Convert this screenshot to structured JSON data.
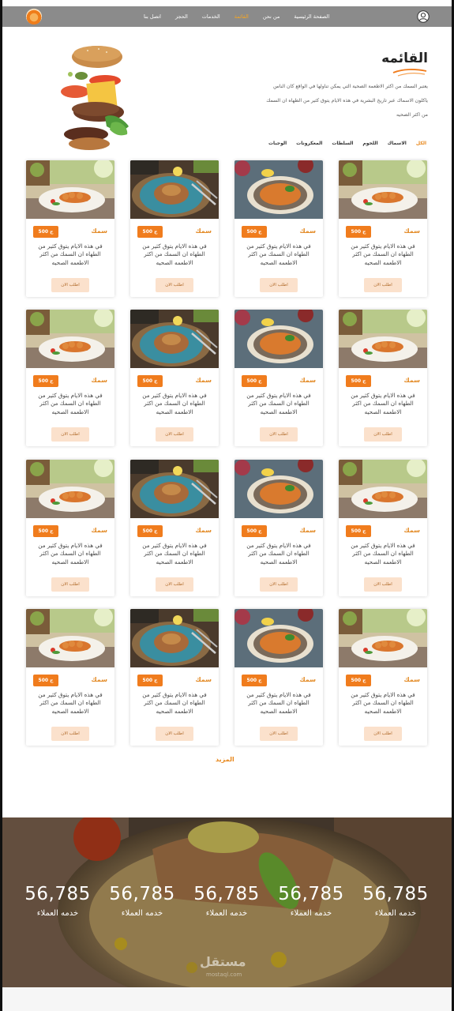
{
  "nav": {
    "links": [
      {
        "label": "الصفحة الرئيسية",
        "active": false
      },
      {
        "label": "من نحن",
        "active": false
      },
      {
        "label": "القائمة",
        "active": true
      },
      {
        "label": "الخدمات",
        "active": false
      },
      {
        "label": "الحجز",
        "active": false
      },
      {
        "label": "اتصل بنا",
        "active": false
      }
    ]
  },
  "hero": {
    "title": "القائمه",
    "description": "يعتبر السمك من اكثر الاطعمة الصحية التي يمكن تناولها في الواقع كان الناس ياكلون الاسماك عبر تاريخ البشرية في هذه الايام يتوق كثير من الطهاه ان السمك من اكثر الصحيه"
  },
  "categories": [
    {
      "label": "الكل",
      "active": true
    },
    {
      "label": "الاسماك",
      "active": false
    },
    {
      "label": "اللحوم",
      "active": false
    },
    {
      "label": "السلطات",
      "active": false
    },
    {
      "label": "المعكرونات",
      "active": false
    },
    {
      "label": "الوجبات",
      "active": false
    }
  ],
  "card": {
    "title": "سمك",
    "price": "500 ج",
    "description": "في هذه الايام يتوق كثير من الطهاه ان السمك من اكثر الاطعمه الصحيه",
    "button": "اطلب الان"
  },
  "more_label": "المزيد",
  "stats": [
    {
      "value": "56,785",
      "label": "خدمه العملاء"
    },
    {
      "value": "56,785",
      "label": "خدمه العملاء"
    },
    {
      "value": "56,785",
      "label": "خدمه العملاء"
    },
    {
      "value": "56,785",
      "label": "خدمه العملاء"
    },
    {
      "value": "56,785",
      "label": "خدمه العملاء"
    }
  ],
  "watermark": {
    "main": "مستقل",
    "sub": "mostaql.com"
  },
  "colors": {
    "accent": "#f07c1d",
    "nav_bg": "#8b8b8b",
    "button_bg": "#fbe1cc"
  }
}
